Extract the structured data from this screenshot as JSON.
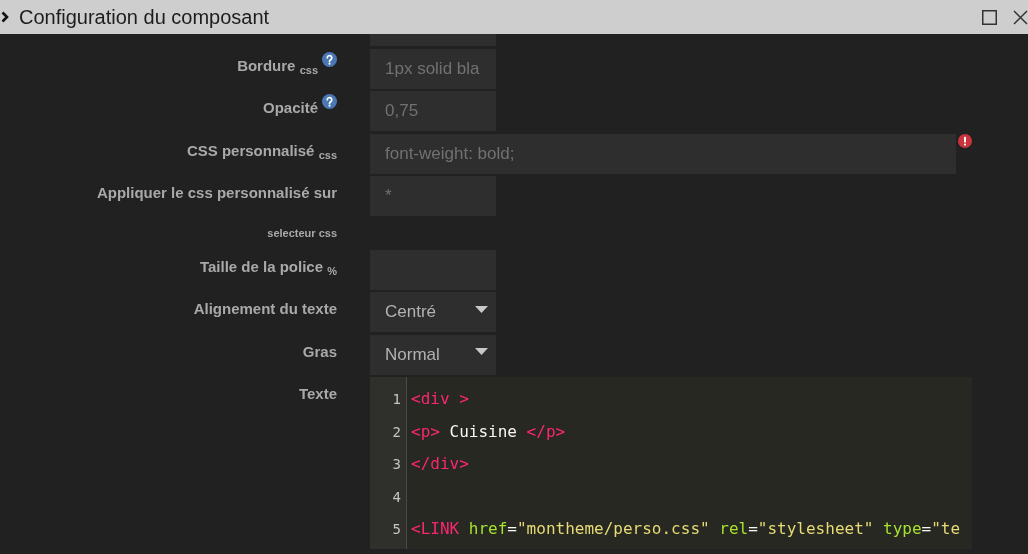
{
  "window": {
    "title": "Configuration du composant"
  },
  "form": {
    "rows": [
      {
        "kind": "clipped"
      },
      {
        "kind": "input",
        "label": "Bordure $_{css}$",
        "help": true,
        "error": false,
        "placeholder": "1px solid bla"
      },
      {
        "kind": "input",
        "label": "Opacité",
        "help": true,
        "error": false,
        "placeholder": "0,75"
      },
      {
        "kind": "wide_input",
        "label": "CSS personnalisé $_{css}$",
        "help": false,
        "error": true,
        "placeholder": "font-weight: bold;"
      },
      {
        "kind": "input",
        "label": "Appliquer le css personnalisé sur $_{selecteur css}$",
        "help": false,
        "error": false,
        "placeholder": "*"
      },
      {
        "kind": "input",
        "label": "Taille de la police $_{%}$",
        "help": false,
        "error": false
      },
      {
        "kind": "select",
        "label": "Alignement du texte",
        "help": false,
        "error": false,
        "value": "Centré"
      },
      {
        "kind": "select",
        "label": "Gras",
        "help": false,
        "error": false,
        "value": "Normal"
      },
      {
        "kind": "code",
        "label": "Texte",
        "help": false,
        "error": false,
        "lines": [
          {
            "number": "1",
            "tokens": [
              {
                "kind": "tag",
                "text": "<div >"
              }
            ]
          },
          {
            "number": "2",
            "tokens": [
              {
                "kind": "tag",
                "text": "<p>"
              },
              {
                "kind": "text",
                "text": " Cuisine "
              },
              {
                "kind": "tag",
                "text": "</p>"
              }
            ]
          },
          {
            "number": "3",
            "tokens": [
              {
                "kind": "tag",
                "text": "</div>"
              }
            ]
          },
          {
            "number": "4"
          },
          {
            "number": "5",
            "tokens": [
              {
                "kind": "tag",
                "text": "<LINK"
              },
              {
                "kind": "attribute",
                "text": " href"
              },
              {
                "kind": "text",
                "text": "="
              },
              {
                "kind": "string",
                "text": "\"montheme/perso.css\""
              },
              {
                "kind": "attribute",
                "text": " rel"
              },
              {
                "kind": "text",
                "text": "="
              },
              {
                "kind": "string",
                "text": "\"stylesheet\""
              },
              {
                "kind": "attribute",
                "text": " type"
              },
              {
                "kind": "text",
                "text": "="
              },
              {
                "kind": "string",
                "text": "\"te"
              }
            ]
          }
        ]
      }
    ]
  }
}
